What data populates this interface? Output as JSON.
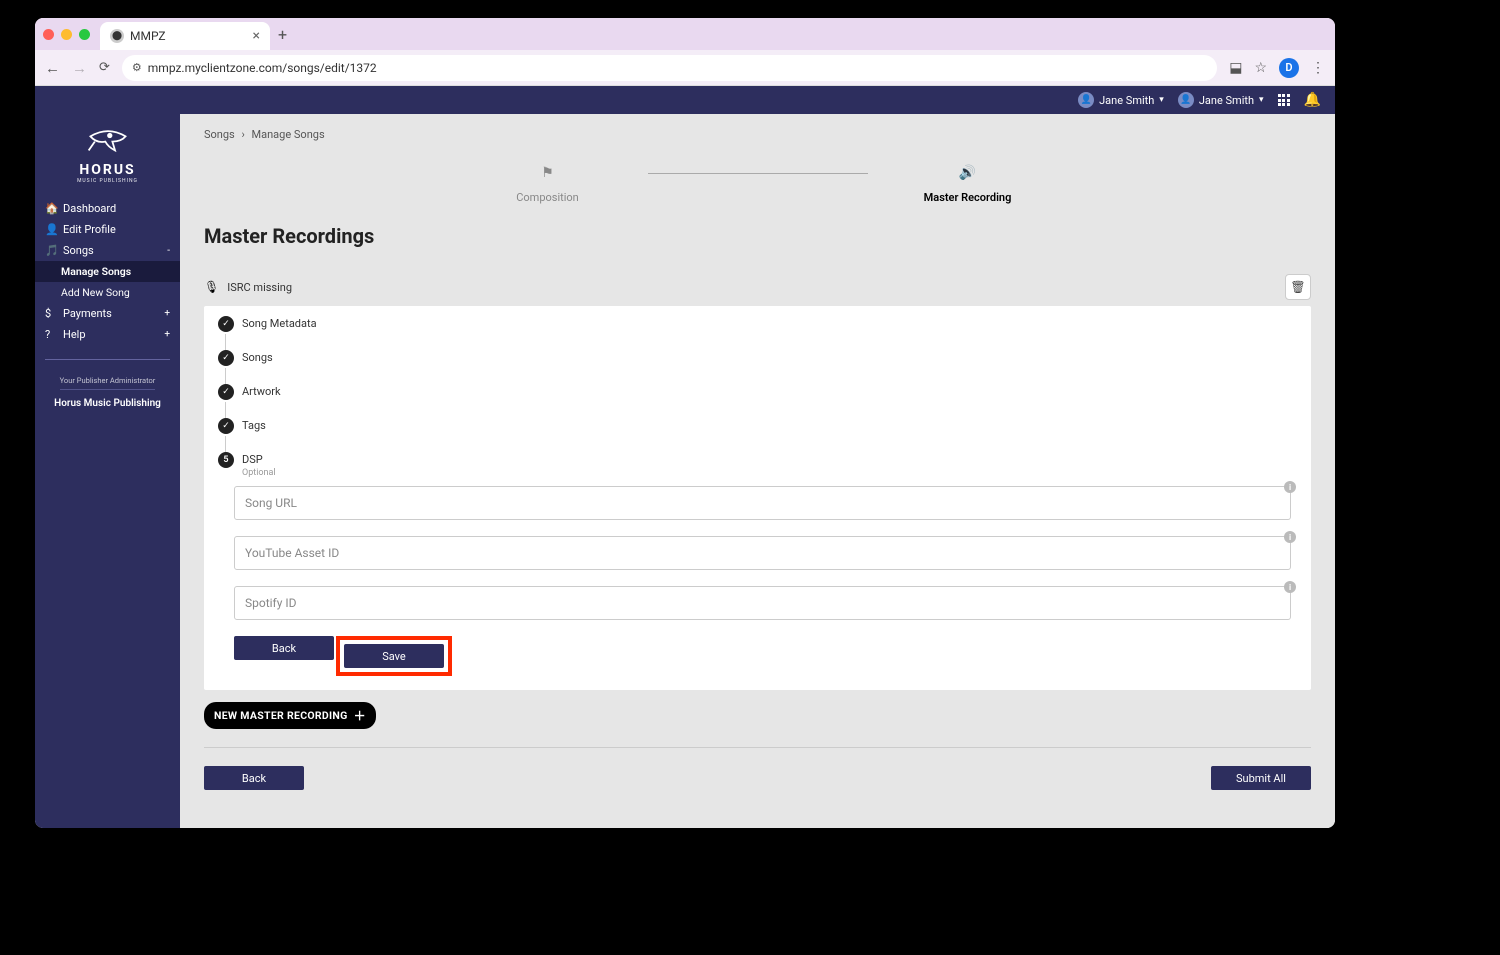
{
  "browser": {
    "tab_title": "MMPZ",
    "url": "mmpz.myclientzone.com/songs/edit/1372",
    "profile_initial": "D"
  },
  "topbar": {
    "user1": "Jane Smith",
    "user2": "Jane Smith"
  },
  "logo": {
    "title": "HORUS",
    "subtitle": "MUSIC PUBLISHING"
  },
  "sidebar": {
    "items": [
      {
        "label": "Dashboard"
      },
      {
        "label": "Edit Profile"
      },
      {
        "label": "Songs",
        "expand": "-"
      },
      {
        "label": "Manage Songs",
        "sub": true,
        "active": true
      },
      {
        "label": "Add New Song",
        "sub": true
      },
      {
        "label": "Payments",
        "expand": "+"
      },
      {
        "label": "Help",
        "expand": "+"
      }
    ],
    "admin_label": "Your Publisher Administrator",
    "admin_name": "Horus Music Publishing"
  },
  "breadcrumb": {
    "a": "Songs",
    "b": "Manage Songs"
  },
  "stepper": {
    "a": "Composition",
    "b": "Master Recording"
  },
  "page": {
    "title": "Master Recordings",
    "record_title": "ISRC missing",
    "vsteps": [
      {
        "label": "Song Metadata",
        "type": "check"
      },
      {
        "label": "Songs",
        "type": "check"
      },
      {
        "label": "Artwork",
        "type": "check"
      },
      {
        "label": "Tags",
        "type": "check"
      },
      {
        "label": "DSP",
        "sublabel": "Optional",
        "type": "num",
        "num": "5"
      }
    ],
    "dsp_fields": {
      "song_url": "Song URL",
      "youtube": "YouTube Asset ID",
      "spotify": "Spotify ID"
    },
    "buttons": {
      "back": "Back",
      "save": "Save",
      "new_master": "NEW MASTER RECORDING",
      "bottom_back": "Back",
      "submit_all": "Submit All"
    }
  }
}
